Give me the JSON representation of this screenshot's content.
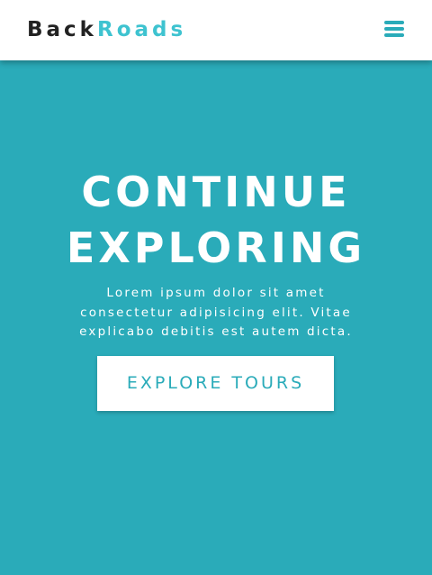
{
  "colors": {
    "primary": "#2aabb9",
    "logo_accent": "#3ec3d0",
    "logo_dark": "#222222",
    "white": "#ffffff"
  },
  "navbar": {
    "logo_part1": "Back",
    "logo_part2": "Roads",
    "menu_icon": "hamburger-menu-icon"
  },
  "hero": {
    "title_line1": "CONTINUE",
    "title_line2": "EXPLORING",
    "text_line1": "Lorem ipsum dolor sit amet",
    "text_line2": "consectetur adipisicing elit. Vitae",
    "text_line3": "explicabo debitis est autem dicta.",
    "button_label": "EXPLORE TOURS"
  }
}
